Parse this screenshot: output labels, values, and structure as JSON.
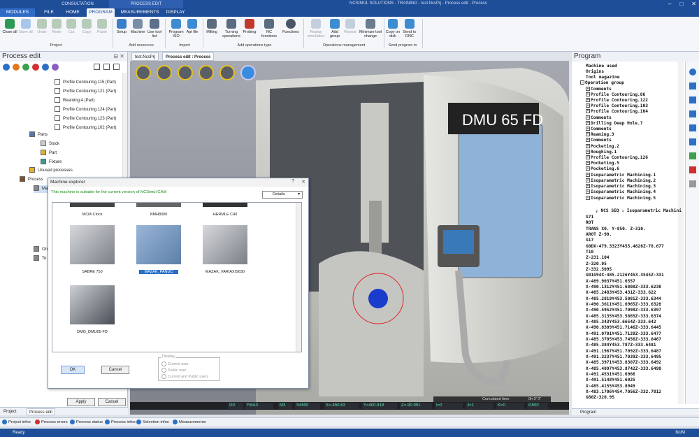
{
  "titlebar": {
    "consultation": "CONSULTATION",
    "process_edit": "PROCESS EDIT",
    "app_title": "NCSIMUL SOLUTIONS - TRAINING - test.NcsPrj - Process edit - Process"
  },
  "tabs": {
    "modules": "MODULES",
    "file": "FILE",
    "home": "HOME",
    "program": "PROGRAM",
    "measurements": "MEASUREMENTS",
    "display": "DISPLAY"
  },
  "ribbon": {
    "buttons": [
      "Close all",
      "Save all",
      "Undo",
      "Redo",
      "Cut",
      "Copy",
      "Paste",
      "Setup",
      "Machine",
      "Use tool list",
      "Program ISO",
      "Apt file",
      "Milling",
      "Turning operations",
      "Probing",
      "NC functions",
      "Functions",
      "Replay simulation",
      "Add group",
      "Repeat",
      "Minimize tool change",
      "Copy on disk",
      "Send to DNC"
    ],
    "groups": [
      "Project",
      "Add resources",
      "Import",
      "Add operations type",
      "Operations management",
      "Send program to"
    ]
  },
  "left_pane": {
    "title": "Process edit",
    "tree": [
      "Profile Contouring.115 (Part)",
      "Profile Contouring.121 (Part)",
      "Reaming.4 (Part)",
      "Profile Contouring.124 (Part)",
      "Profile Contouring.123 (Part)",
      "Profile Contouring.102 (Part)",
      "Parts",
      "Stock",
      "Part",
      "Fixture",
      "Unused processes",
      "Process",
      "Ma",
      "On",
      "To"
    ],
    "apply": "Apply",
    "cancel": "Cancel",
    "bottom_tabs": [
      "Project",
      "Process edit"
    ]
  },
  "doc_tabs": [
    "test.NcsPrj",
    "Process edit : Process"
  ],
  "viewport": {
    "machine_label": "DMU 65 FD"
  },
  "coords": {
    "g": "G0",
    "feed": "FMAX",
    "m": "M3",
    "s": "S4500",
    "x": "X=-450.63",
    "y": "Y=400.918",
    "z": "Z=-90.951",
    "i": "I=0",
    "j": "J=1",
    "k": "K=0",
    "g500": "G500",
    "cumulated_label": "Cumulated time",
    "cumulated_value": "0h 0' 0\""
  },
  "dialog": {
    "title": "Machine explorer",
    "message": "This machine is suitable for the current version of NCSimul CAM",
    "details": "Details",
    "machines": [
      "MCM-Clock",
      "NMH8000",
      "HERMLE C40",
      "SABRE 750",
      "MAZAK_PANUC",
      "MAZAK_VARIAXIS630",
      "DMG_DMU65-FD"
    ],
    "ok": "OK",
    "cancel": "Cancel",
    "display_label": "Display",
    "radios": [
      "Current user",
      "Public user",
      "Current and Public users"
    ]
  },
  "right_pane": {
    "title": "Program",
    "tree": [
      "Machine used",
      "Origins",
      "Tool magazine",
      "Operation group",
      "Comments",
      "Profile Contouring.86",
      "Profile Contouring.122",
      "Profile Contouring.103",
      "Profile Contouring.104",
      "Comments",
      "Drilling Deep Hole.7",
      "Comments",
      "Reaming.3",
      "Comments",
      "Pocketing.2",
      "Roughing.1",
      "Profile Contouring.126",
      "Pocketing.5",
      "Pocketing.6",
      "Isoparametric Machining.1",
      "Isoparametric Machining.2",
      "Isoparametric Machining.3",
      "Isoparametric Machining.4",
      "Isoparametric Machining.5"
    ],
    "nc": [
      "; NCS SEQ : Isoparametric Machini",
      "G71",
      "ROT",
      "TRANS X0. Y-850. Z-310.",
      "AROT Z-90.",
      "G17",
      "G0DX-479.3323Y455.4826Z-78.677",
      "T10",
      "Z-231.104",
      "Z-320.95",
      "Z-332.5095",
      "G01G94X-485.2126Y453.3545Z-331",
      "X-489.9037Y451.6557",
      "X-490.1312Y451.6808Z-333.6238",
      "X-485.2483Y453.431Z-333.622",
      "X-485.2819Y453.5081Z-333.6344",
      "X-490.3611Y451.6965Z-333.6328",
      "X-490.5952Y451.7098Z-333.6397",
      "X-485.3135Y453.5865Z-333.6374",
      "X-485.343Y453.6654Z-333.642",
      "X-490.8309Y451.7146Z-333.6445",
      "X-491.0701Y451.7128Z-333.6477",
      "X-485.3705Y453.7456Z-333.6467",
      "X-485.384Y453.787Z-333.6481",
      "X-491.1967Y451.7092Z-333.6487",
      "X-491.3237Y451.7039Z-333.6495",
      "X-485.3971Y453.8307Z-333.6492",
      "X-485.4097Y453.8742Z-333.6498",
      "X-491.4531Y451.6966",
      "X-491.5148Y451.6925",
      "X-485.4155Y453.8949",
      "X-483.1706Y454.7056Z-332.7812",
      "G80Z-320.95"
    ],
    "bottom_tab": "Program"
  },
  "statusbar": [
    "Project infos",
    "Process errors",
    "Process status",
    "Process infos",
    "Selection infos",
    "Measurements"
  ],
  "readybar": {
    "left": "Ready",
    "right": "NUM"
  },
  "colors": {
    "accent": "#1f4e99",
    "selection": "#2b6fc8",
    "coord_text": "#58e0b0"
  }
}
